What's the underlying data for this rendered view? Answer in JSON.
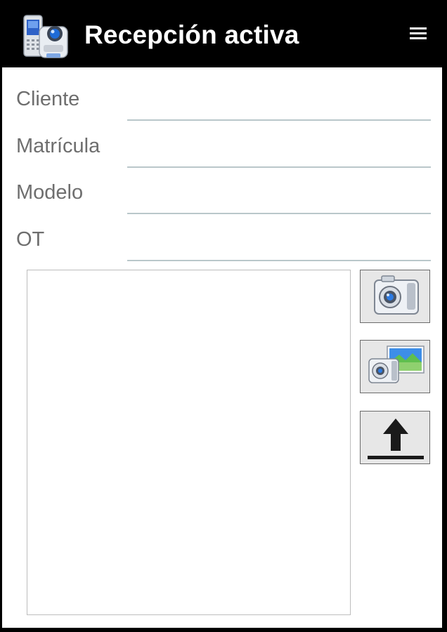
{
  "header": {
    "title": "Recepción activa",
    "app_icon": "phone-camera-icon",
    "menu_icon": "menu-icon"
  },
  "form": {
    "fields": [
      {
        "label": "Cliente",
        "value": ""
      },
      {
        "label": "Matrícula",
        "value": ""
      },
      {
        "label": "Modelo",
        "value": ""
      },
      {
        "label": "OT",
        "value": ""
      }
    ]
  },
  "actions": {
    "take_photo_icon": "camera-icon",
    "gallery_icon": "camera-gallery-icon",
    "upload_icon": "upload-arrow-icon"
  },
  "colors": {
    "header_bg": "#000000",
    "title_text": "#ffffff",
    "label_text": "#6e6e6e",
    "input_underline": "#b9c7ca"
  }
}
